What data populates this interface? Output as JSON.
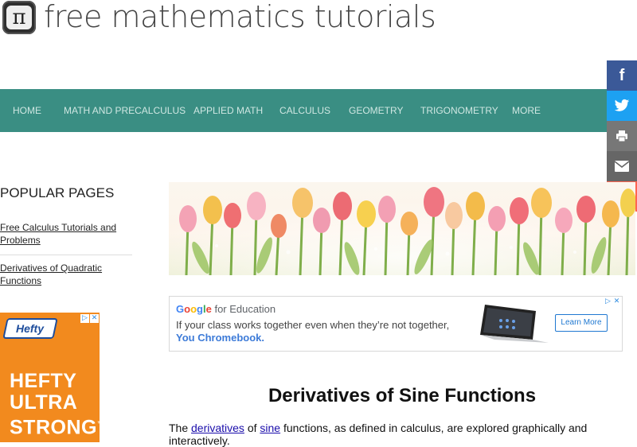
{
  "header": {
    "logo_symbol": "π",
    "site_title": "free mathematics tutorials"
  },
  "nav": {
    "items": [
      {
        "label": "HOME"
      },
      {
        "label": "MATH AND PRECALCULUS"
      },
      {
        "label": "APPLIED MATH"
      },
      {
        "label": "CALCULUS"
      },
      {
        "label": "GEOMETRY"
      },
      {
        "label": "TRIGONOMETRY"
      },
      {
        "label": "MORE"
      }
    ]
  },
  "social": [
    {
      "name": "facebook",
      "glyph": "f",
      "color": "#3b5998"
    },
    {
      "name": "twitter",
      "glyph": "🐦",
      "color": "#1da1f2"
    },
    {
      "name": "print",
      "glyph": "🖨",
      "color": "#777777"
    },
    {
      "name": "email",
      "glyph": "✉",
      "color": "#666666"
    },
    {
      "name": "more",
      "glyph": "+",
      "color": "#ff6550"
    }
  ],
  "sidebar": {
    "title": "POPULAR PAGES",
    "links": [
      {
        "label": "Free Calculus Tutorials and Problems"
      },
      {
        "label": "Derivatives of Quadratic Functions"
      }
    ]
  },
  "side_ad": {
    "brand": "Hefty",
    "headline": [
      "HEFTY",
      "ULTRA",
      "STRONG"
    ],
    "mark": "™",
    "adchoice": "▷",
    "close": "✕"
  },
  "google_ad": {
    "brand_google": "Google",
    "brand_rest": " for Education",
    "line1": "If your class works together even when they’re not together,",
    "line2": "You Chromebook.",
    "button": "Learn More",
    "adchoice": "▷",
    "close": "✕"
  },
  "article": {
    "title": "Derivatives of Sine Functions",
    "intro_prefix": "The ",
    "link1": "derivatives",
    "mid1": " of ",
    "link2": "sine",
    "intro_suffix": " functions, as defined in calculus, are explored graphically and interactively."
  },
  "colors": {
    "nav_bg": "#3a8e83",
    "nav_text": "#cfe7e2",
    "ad_orange": "#f28a1e",
    "hefty_blue": "#1e4d9c"
  }
}
